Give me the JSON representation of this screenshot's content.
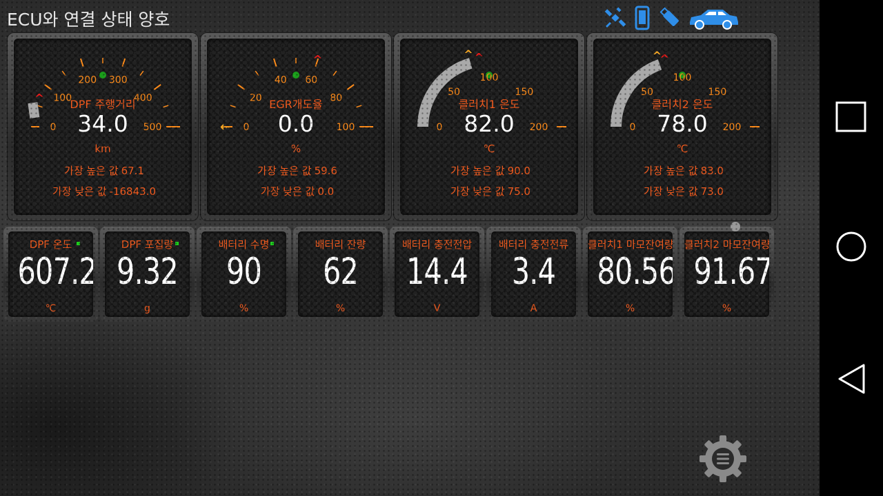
{
  "header": {
    "title": "ECU와 연결 상태 양호",
    "icons": [
      "satellite-icon",
      "phone-icon",
      "usb-stick-icon",
      "car-icon"
    ],
    "icon_color": "#2f8ee8"
  },
  "gauges": [
    {
      "title": "DPF 주행거리",
      "value": "34.0",
      "unit": "km",
      "max_label": "가장 높은 값",
      "max_value": "67.1",
      "min_label": "가장 낮은 값",
      "min_value": "-16843.0",
      "scale": [
        0,
        500
      ],
      "labels": [
        "0",
        "100",
        "200",
        "300",
        "400",
        "500"
      ],
      "fill_fraction": 0.068,
      "marker_fraction": 0.134,
      "style": "ticks"
    },
    {
      "title": "EGR개도율",
      "value": "0.0",
      "unit": "%",
      "max_label": "가장 높은 값",
      "max_value": "59.6",
      "min_label": "가장 낮은 값",
      "min_value": "0.0",
      "scale": [
        0,
        100
      ],
      "labels": [
        "0",
        "20",
        "40",
        "60",
        "80",
        "100"
      ],
      "fill_fraction": 0.0,
      "marker_fraction": 0.596,
      "style": "ticks"
    },
    {
      "title": "클러치1 온도",
      "value": "82.0",
      "unit": "℃",
      "max_label": "가장 높은 값",
      "max_value": "90.0",
      "min_label": "가장 낮은 값",
      "min_value": "75.0",
      "scale": [
        0,
        200
      ],
      "labels": [
        "0",
        "50",
        "100",
        "150",
        "200"
      ],
      "fill_fraction": 0.41,
      "marker_fraction": 0.45,
      "style": "arc"
    },
    {
      "title": "클러치2 온도",
      "value": "78.0",
      "unit": "℃",
      "max_label": "가장 높은 값",
      "max_value": "83.0",
      "min_label": "가장 낮은 값",
      "min_value": "73.0",
      "scale": [
        0,
        200
      ],
      "labels": [
        "0",
        "50",
        "100",
        "150",
        "200"
      ],
      "fill_fraction": 0.39,
      "marker_fraction": 0.415,
      "style": "arc"
    }
  ],
  "tiles": [
    {
      "title": "DPF 온도",
      "value": "607.2",
      "unit": "℃"
    },
    {
      "title": "DPF 포집량",
      "value": "9.32",
      "unit": "g"
    },
    {
      "title": "배터리 수명",
      "value": "90",
      "unit": "%"
    },
    {
      "title": "배터리 잔량",
      "value": "62",
      "unit": "%"
    },
    {
      "title": "배터리 충전전압",
      "value": "14.4",
      "unit": "V"
    },
    {
      "title": "배터리 충전전류",
      "value": "3.4",
      "unit": "A"
    },
    {
      "title": "클러치1 마모잔여량",
      "value": "80.56",
      "unit": "%"
    },
    {
      "title": "클러치2 마모잔여량",
      "value": "91.67",
      "unit": "%"
    }
  ],
  "colors": {
    "label_orange": "#f05a1e",
    "tick_orange": "#ff8c1a",
    "needle_yellow": "#f5a623",
    "marker_red": "#e81b1b",
    "indicator_green": "#1ecf1e",
    "value_white": "#ffffff"
  },
  "navbar": {
    "buttons": [
      "recents-square-icon",
      "home-circle-icon",
      "back-triangle-icon"
    ]
  },
  "settings": {
    "icon": "settings-gear-menu-icon"
  }
}
